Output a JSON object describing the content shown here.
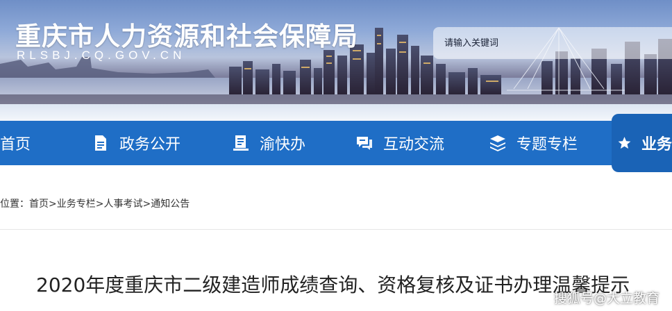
{
  "header": {
    "site_title": "重庆市人力资源和社会保障局",
    "site_domain": "RLSBJ.CQ.GOV.CN",
    "search_placeholder": "请输入关键词"
  },
  "nav": {
    "items": [
      {
        "label": "首页",
        "icon": "none"
      },
      {
        "label": "政务公开",
        "icon": "document-icon"
      },
      {
        "label": "渝快办",
        "icon": "clipboard-icon"
      },
      {
        "label": "互动交流",
        "icon": "chat-icon"
      },
      {
        "label": "专题专栏",
        "icon": "layers-icon"
      },
      {
        "label": "业务",
        "icon": "star-icon",
        "active": true
      }
    ],
    "color": "#1f6ec6",
    "active_color": "#1a63b6"
  },
  "breadcrumb": {
    "prefix": "位置：",
    "items": [
      "首页",
      "业务专栏",
      "人事考试",
      "通知公告"
    ],
    "separator": ">"
  },
  "article": {
    "title": "2020年度重庆市二级建造师成绩查询、资格复核及证书办理温馨提示"
  },
  "watermark": {
    "text": "搜狐号@大立教育"
  }
}
